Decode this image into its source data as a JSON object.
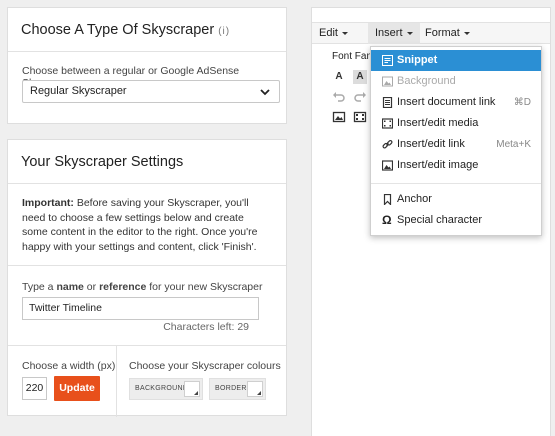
{
  "type_panel": {
    "title": "Choose A Type Of Skyscraper",
    "info": "(i)",
    "label": "Choose between a regular or Google AdSense Skyscraper",
    "selected": "Regular Skyscraper"
  },
  "settings_panel": {
    "title": "Your Skyscraper Settings",
    "important_label": "Important:",
    "important_text": " Before saving your Skyscraper, you'll need to choose a few settings below and create some content in the editor to the right. Once you're happy with your settings and content, click 'Finish'.",
    "name_label_pre": "Type a ",
    "name_label_b1": "name",
    "name_label_mid": " or ",
    "name_label_b2": "reference",
    "name_label_post": " for your new Skyscraper",
    "name_value": "Twitter Timeline",
    "chars_left": "Characters left: 29",
    "width_label": "Choose a width (px)",
    "width_value": "220",
    "update_label": "Update",
    "colours_label": "Choose your Skyscraper colours",
    "background_label": "BACKGROUND",
    "border_label": "BORDER"
  },
  "editor": {
    "menu": [
      "Edit",
      "Insert",
      "Format"
    ],
    "font_family_label": "Font Fam",
    "toolbar_a1": "A",
    "toolbar_a2": "A"
  },
  "insert_menu": {
    "items": [
      {
        "label": "Snippet",
        "icon": "snippet-icon",
        "state": "selected"
      },
      {
        "label": "Background",
        "icon": "image-icon",
        "state": "disabled"
      },
      {
        "label": "Insert document link",
        "icon": "document-icon",
        "shortcut": "⌘D"
      },
      {
        "label": "Insert/edit media",
        "icon": "media-icon"
      },
      {
        "label": "Insert/edit link",
        "icon": "link-icon",
        "shortcut": "Meta+K"
      },
      {
        "label": "Insert/edit image",
        "icon": "image-icon"
      },
      {
        "label": "Anchor",
        "icon": "bookmark-icon"
      },
      {
        "label": "Special character",
        "icon": "omega-icon"
      }
    ]
  },
  "colors": {
    "accent": "#e8501b",
    "menu_selected": "#2b8fd4"
  }
}
